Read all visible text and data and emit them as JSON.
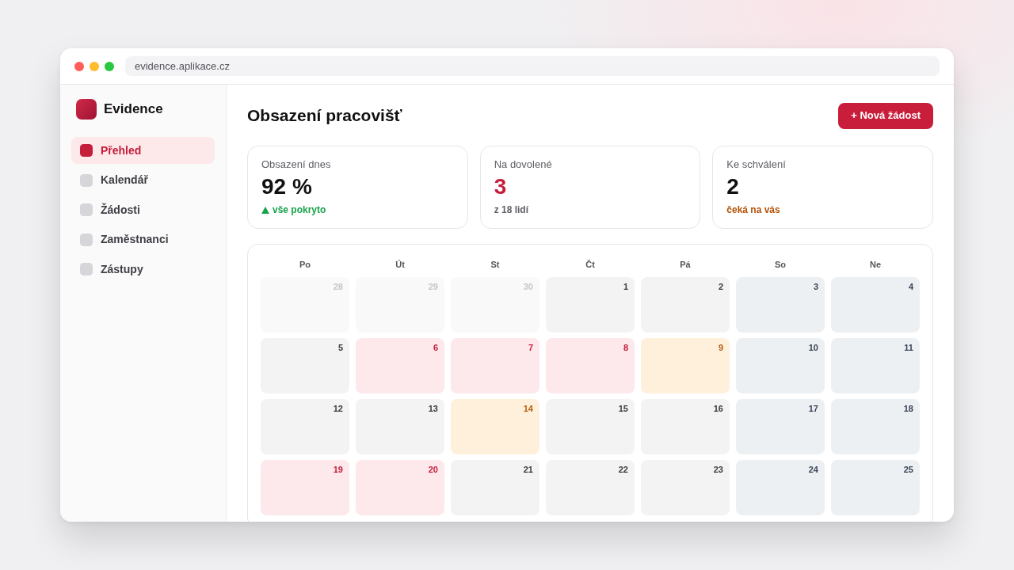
{
  "browser": {
    "url": "evidence.aplikace.cz"
  },
  "sidebar": {
    "brand": "Evidence",
    "items": [
      {
        "label": "Přehled",
        "selected": true
      },
      {
        "label": "Kalendář",
        "selected": false
      },
      {
        "label": "Žádosti",
        "selected": false
      },
      {
        "label": "Zaměstnanci",
        "selected": false
      },
      {
        "label": "Zástupy",
        "selected": false
      }
    ]
  },
  "header": {
    "title": "Obsazení pracovišť",
    "new_button": "+ Nová žádost"
  },
  "stats": [
    {
      "kind": "coverage",
      "label": "Obsazení dnes",
      "value": "92 %",
      "note": "vše pokryto"
    },
    {
      "kind": "absence",
      "label": "Na dovolené",
      "value": "3",
      "note": "z 18 lidí"
    },
    {
      "kind": "approval",
      "label": "Ke schválení",
      "value": "2",
      "note": "čeká na vás"
    }
  ],
  "calendar": {
    "weekdays": [
      "Po",
      "Út",
      "St",
      "Čt",
      "Pá",
      "So",
      "Ne"
    ],
    "weeks": [
      [
        {
          "day": "28",
          "kind": "outside"
        },
        {
          "day": "29",
          "kind": "outside"
        },
        {
          "day": "30",
          "kind": "outside"
        },
        {
          "day": "1",
          "kind": "workday"
        },
        {
          "day": "2",
          "kind": "workday"
        },
        {
          "day": "3",
          "kind": "weekend"
        },
        {
          "day": "4",
          "kind": "weekend"
        }
      ],
      [
        {
          "day": "5",
          "kind": "workday"
        },
        {
          "day": "6",
          "kind": "leave"
        },
        {
          "day": "7",
          "kind": "leave"
        },
        {
          "day": "8",
          "kind": "leave"
        },
        {
          "day": "9",
          "kind": "pending"
        },
        {
          "day": "10",
          "kind": "weekend"
        },
        {
          "day": "11",
          "kind": "weekend"
        }
      ],
      [
        {
          "day": "12",
          "kind": "workday"
        },
        {
          "day": "13",
          "kind": "workday"
        },
        {
          "day": "14",
          "kind": "pending"
        },
        {
          "day": "15",
          "kind": "workday"
        },
        {
          "day": "16",
          "kind": "workday"
        },
        {
          "day": "17",
          "kind": "weekend"
        },
        {
          "day": "18",
          "kind": "weekend"
        }
      ],
      [
        {
          "day": "19",
          "kind": "leave"
        },
        {
          "day": "20",
          "kind": "leave"
        },
        {
          "day": "21",
          "kind": "workday"
        },
        {
          "day": "22",
          "kind": "workday"
        },
        {
          "day": "23",
          "kind": "workday"
        },
        {
          "day": "24",
          "kind": "weekend"
        },
        {
          "day": "25",
          "kind": "weekend"
        }
      ]
    ]
  }
}
